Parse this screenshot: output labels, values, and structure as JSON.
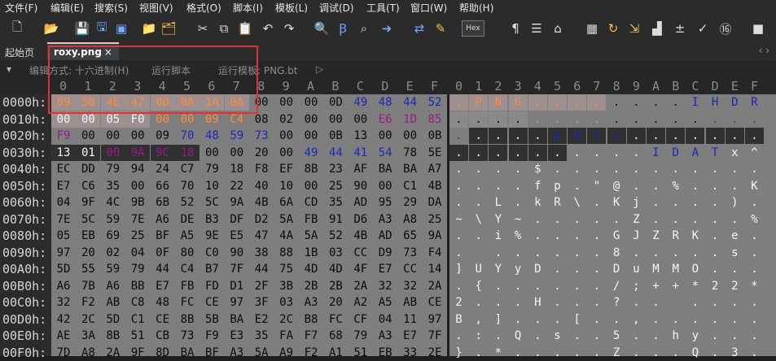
{
  "menu": [
    "文件(F)",
    "编辑(E)",
    "搜索(S)",
    "视图(V)",
    "格式(O)",
    "脚本(I)",
    "模板(L)",
    "调试(D)",
    "工具(T)",
    "窗口(W)",
    "帮助(H)"
  ],
  "toolbar": {
    "hex_label": "Hex",
    "paragraph_label": "¶"
  },
  "tabs": {
    "start": "起始页",
    "active": "roxy.png",
    "close": "×"
  },
  "options": {
    "edit_mode": "编辑方式: 十六进制(H)",
    "run_script": "运行脚本",
    "run_template": "运行模板: PNG.bt",
    "play": "▷"
  },
  "hex_columns": [
    "0",
    "1",
    "2",
    "3",
    "4",
    "5",
    "6",
    "7",
    "8",
    "9",
    "A",
    "B",
    "C",
    "D",
    "E",
    "F"
  ],
  "ascii_columns": [
    "0",
    "1",
    "2",
    "3",
    "4",
    "5",
    "6",
    "7",
    "8",
    "9",
    "A",
    "B",
    "C",
    "D",
    "E",
    "F"
  ],
  "colors": {
    "selection_bg": "#9d8f8f",
    "dark_bg": "#303030",
    "orange": "#ff8a3d",
    "blue": "#1c28b8",
    "purple": "#9a1b8a",
    "highlight_box": "#e43030"
  },
  "rows": [
    {
      "addr": "0000h:",
      "bytes": [
        "89",
        "50",
        "4E",
        "47",
        "0D",
        "0A",
        "1A",
        "0A",
        "00",
        "00",
        "00",
        "0D",
        "49",
        "48",
        "44",
        "52"
      ],
      "ascii": [
        ".",
        "P",
        "N",
        "G",
        ".",
        ".",
        ".",
        ".",
        ".",
        ".",
        ".",
        ".",
        "I",
        "H",
        "D",
        "R"
      ]
    },
    {
      "addr": "0010h:",
      "bytes": [
        "00",
        "00",
        "05",
        "F0",
        "00",
        "00",
        "09",
        "C4",
        "08",
        "02",
        "00",
        "00",
        "00",
        "E6",
        "1D",
        "85"
      ],
      "ascii": [
        ".",
        ".",
        ".",
        ".",
        ".",
        ".",
        ".",
        ".",
        ".",
        ".",
        ".",
        ".",
        ".",
        ".",
        ".",
        "."
      ]
    },
    {
      "addr": "0020h:",
      "bytes": [
        "F9",
        "00",
        "00",
        "00",
        "09",
        "70",
        "48",
        "59",
        "73",
        "00",
        "00",
        "0B",
        "13",
        "00",
        "00",
        "0B"
      ],
      "ascii": [
        ".",
        ".",
        ".",
        ".",
        ".",
        "p",
        "H",
        "Y",
        "s",
        ".",
        ".",
        ".",
        ".",
        ".",
        ".",
        "."
      ]
    },
    {
      "addr": "0030h:",
      "bytes": [
        "13",
        "01",
        "00",
        "9A",
        "9C",
        "18",
        "00",
        "00",
        "20",
        "00",
        "49",
        "44",
        "41",
        "54",
        "78",
        "5E"
      ],
      "ascii": [
        ".",
        ".",
        ".",
        ".",
        ".",
        ".",
        ".",
        ".",
        ".",
        ".",
        "I",
        "D",
        "A",
        "T",
        "x",
        "^"
      ]
    },
    {
      "addr": "0040h:",
      "bytes": [
        "EC",
        "DD",
        "79",
        "94",
        "24",
        "C7",
        "79",
        "18",
        "F8",
        "EF",
        "8B",
        "23",
        "AF",
        "BA",
        "BA",
        "A7"
      ],
      "ascii": [
        ".",
        ".",
        ".",
        ".",
        "$",
        ".",
        ".",
        ".",
        ".",
        ".",
        ".",
        ".",
        ".",
        ".",
        ".",
        "."
      ]
    },
    {
      "addr": "0050h:",
      "bytes": [
        "E7",
        "C6",
        "35",
        "00",
        "66",
        "70",
        "10",
        "22",
        "40",
        "10",
        "00",
        "25",
        "90",
        "00",
        "C1",
        "4B"
      ],
      "ascii": [
        ".",
        ".",
        ".",
        ".",
        "f",
        "p",
        ".",
        "\"",
        "@",
        ".",
        ".",
        "%",
        ".",
        ".",
        ".",
        "K"
      ]
    },
    {
      "addr": "0060h:",
      "bytes": [
        "04",
        "9F",
        "4C",
        "9B",
        "6B",
        "52",
        "5C",
        "9A",
        "4B",
        "6A",
        "CD",
        "35",
        "AD",
        "95",
        "29",
        "DA"
      ],
      "ascii": [
        ".",
        ".",
        "L",
        ".",
        "k",
        "R",
        "\\",
        ".",
        "K",
        "j",
        ".",
        ".",
        ".",
        ".",
        ")",
        "."
      ]
    },
    {
      "addr": "0070h:",
      "bytes": [
        "7E",
        "5C",
        "59",
        "7E",
        "A6",
        "DE",
        "B3",
        "DF",
        "D2",
        "5A",
        "FB",
        "91",
        "D6",
        "A3",
        "A8",
        "25"
      ],
      "ascii": [
        "~",
        "\\",
        "Y",
        "~",
        ".",
        ".",
        ".",
        ".",
        ".",
        "Z",
        ".",
        ".",
        ".",
        ".",
        ".",
        "%"
      ]
    },
    {
      "addr": "0080h:",
      "bytes": [
        "05",
        "EB",
        "69",
        "25",
        "BF",
        "A5",
        "9E",
        "E5",
        "47",
        "4A",
        "5A",
        "52",
        "4B",
        "AD",
        "65",
        "9A"
      ],
      "ascii": [
        ".",
        ".",
        "i",
        "%",
        ".",
        ".",
        ".",
        ".",
        "G",
        "J",
        "Z",
        "R",
        "K",
        ".",
        "e",
        "."
      ]
    },
    {
      "addr": "0090h:",
      "bytes": [
        "97",
        "20",
        "02",
        "04",
        "0F",
        "80",
        "C0",
        "90",
        "38",
        "88",
        "1B",
        "03",
        "CC",
        "D9",
        "73",
        "F4"
      ],
      "ascii": [
        ".",
        " ",
        ".",
        ".",
        ".",
        ".",
        ".",
        ".",
        "8",
        ".",
        ".",
        ".",
        ".",
        ".",
        "s",
        "."
      ]
    },
    {
      "addr": "00A0h:",
      "bytes": [
        "5D",
        "55",
        "59",
        "79",
        "44",
        "C4",
        "B7",
        "7F",
        "44",
        "75",
        "4D",
        "4D",
        "4F",
        "E7",
        "CC",
        "14"
      ],
      "ascii": [
        "]",
        "U",
        "Y",
        "y",
        "D",
        ".",
        ".",
        ".",
        "D",
        "u",
        "M",
        "M",
        "O",
        ".",
        ".",
        "."
      ]
    },
    {
      "addr": "00B0h:",
      "bytes": [
        "A6",
        "7B",
        "A6",
        "BB",
        "E7",
        "FB",
        "FD",
        "D1",
        "2F",
        "3B",
        "2B",
        "2B",
        "2A",
        "32",
        "32",
        "2A"
      ],
      "ascii": [
        ".",
        "{",
        ".",
        ".",
        ".",
        ".",
        ".",
        ".",
        "/",
        ";",
        "+",
        "+",
        "*",
        "2",
        "2",
        "*"
      ]
    },
    {
      "addr": "00C0h:",
      "bytes": [
        "32",
        "F2",
        "AB",
        "C8",
        "48",
        "FC",
        "CE",
        "97",
        "3F",
        "03",
        "A3",
        "20",
        "A2",
        "A5",
        "AB",
        "CE"
      ],
      "ascii": [
        "2",
        ".",
        ".",
        ".",
        "H",
        ".",
        ".",
        ".",
        "?",
        ".",
        ".",
        " ",
        ".",
        ".",
        ".",
        "."
      ]
    },
    {
      "addr": "00D0h:",
      "bytes": [
        "42",
        "2C",
        "5D",
        "C1",
        "CE",
        "8B",
        "5B",
        "BA",
        "E2",
        "2C",
        "B8",
        "FC",
        "CF",
        "04",
        "11",
        "97"
      ],
      "ascii": [
        "B",
        ",",
        "]",
        ".",
        ".",
        ".",
        "[",
        ".",
        ".",
        ",",
        ".",
        ".",
        ".",
        ".",
        ".",
        "."
      ]
    },
    {
      "addr": "00E0h:",
      "bytes": [
        "AE",
        "3A",
        "8B",
        "51",
        "CB",
        "73",
        "F9",
        "E3",
        "35",
        "FA",
        "F7",
        "68",
        "79",
        "A3",
        "E7",
        "7F"
      ],
      "ascii": [
        ".",
        ":",
        ".",
        "Q",
        ".",
        "s",
        ".",
        ".",
        "5",
        ".",
        ".",
        "h",
        "y",
        ".",
        ".",
        "."
      ]
    },
    {
      "addr": "00F0h:",
      "bytes": [
        "7D",
        "A8",
        "2A",
        "9F",
        "8D",
        "BA",
        "BF",
        "A3",
        "5A",
        "A9",
        "F2",
        "A1",
        "51",
        "EB",
        "33",
        "2E"
      ],
      "ascii": [
        "}",
        ".",
        "*",
        ".",
        ".",
        ".",
        ".",
        ".",
        "Z",
        ".",
        ".",
        ".",
        "Q",
        ".",
        "3",
        "."
      ]
    }
  ]
}
